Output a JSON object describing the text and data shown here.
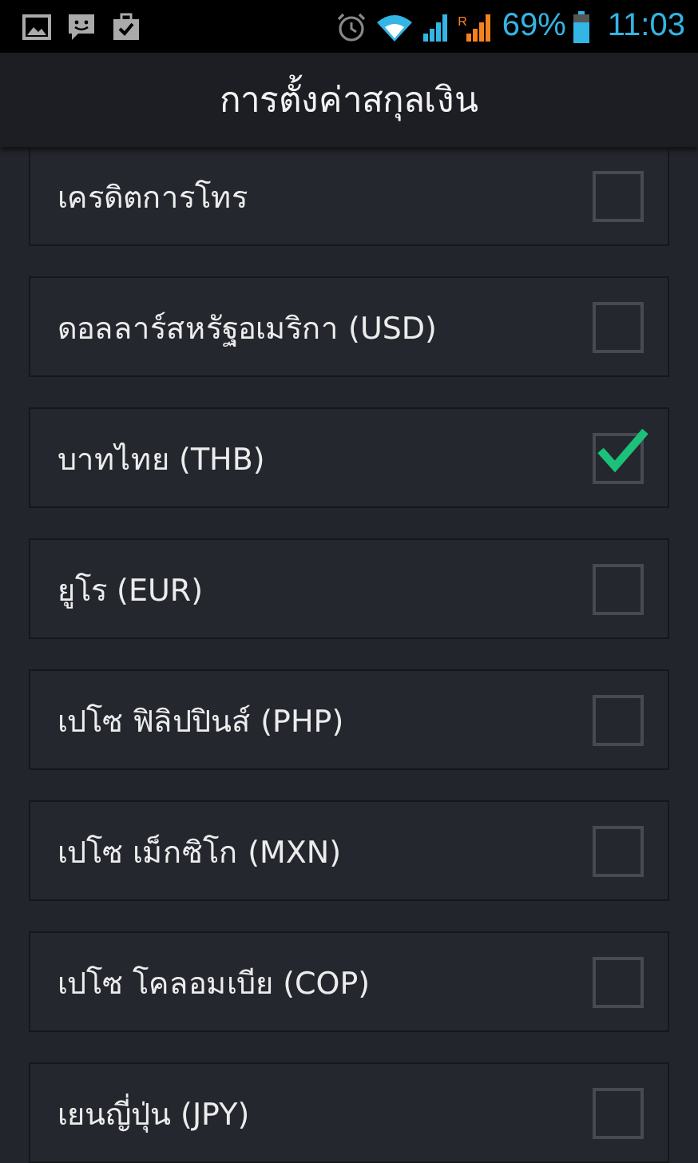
{
  "status_bar": {
    "roaming": "R",
    "battery": "69%",
    "time": "11:03"
  },
  "title": "การตั้งค่าสกุลเงิน",
  "currencies": [
    {
      "label": "เครดิตการโทร",
      "checked": false
    },
    {
      "label": "ดอลลาร์สหรัฐอเมริกา (USD)",
      "checked": false
    },
    {
      "label": "บาทไทย (THB)",
      "checked": true
    },
    {
      "label": "ยูโร (EUR)",
      "checked": false
    },
    {
      "label": "เปโซ ฟิลิปปินส์ (PHP)",
      "checked": false
    },
    {
      "label": "เปโซ เม็กซิโก (MXN)",
      "checked": false
    },
    {
      "label": "เปโซ โคลอมเบีย (COP)",
      "checked": false
    },
    {
      "label": "เยนญี่ปุ่น (JPY)",
      "checked": false
    }
  ]
}
